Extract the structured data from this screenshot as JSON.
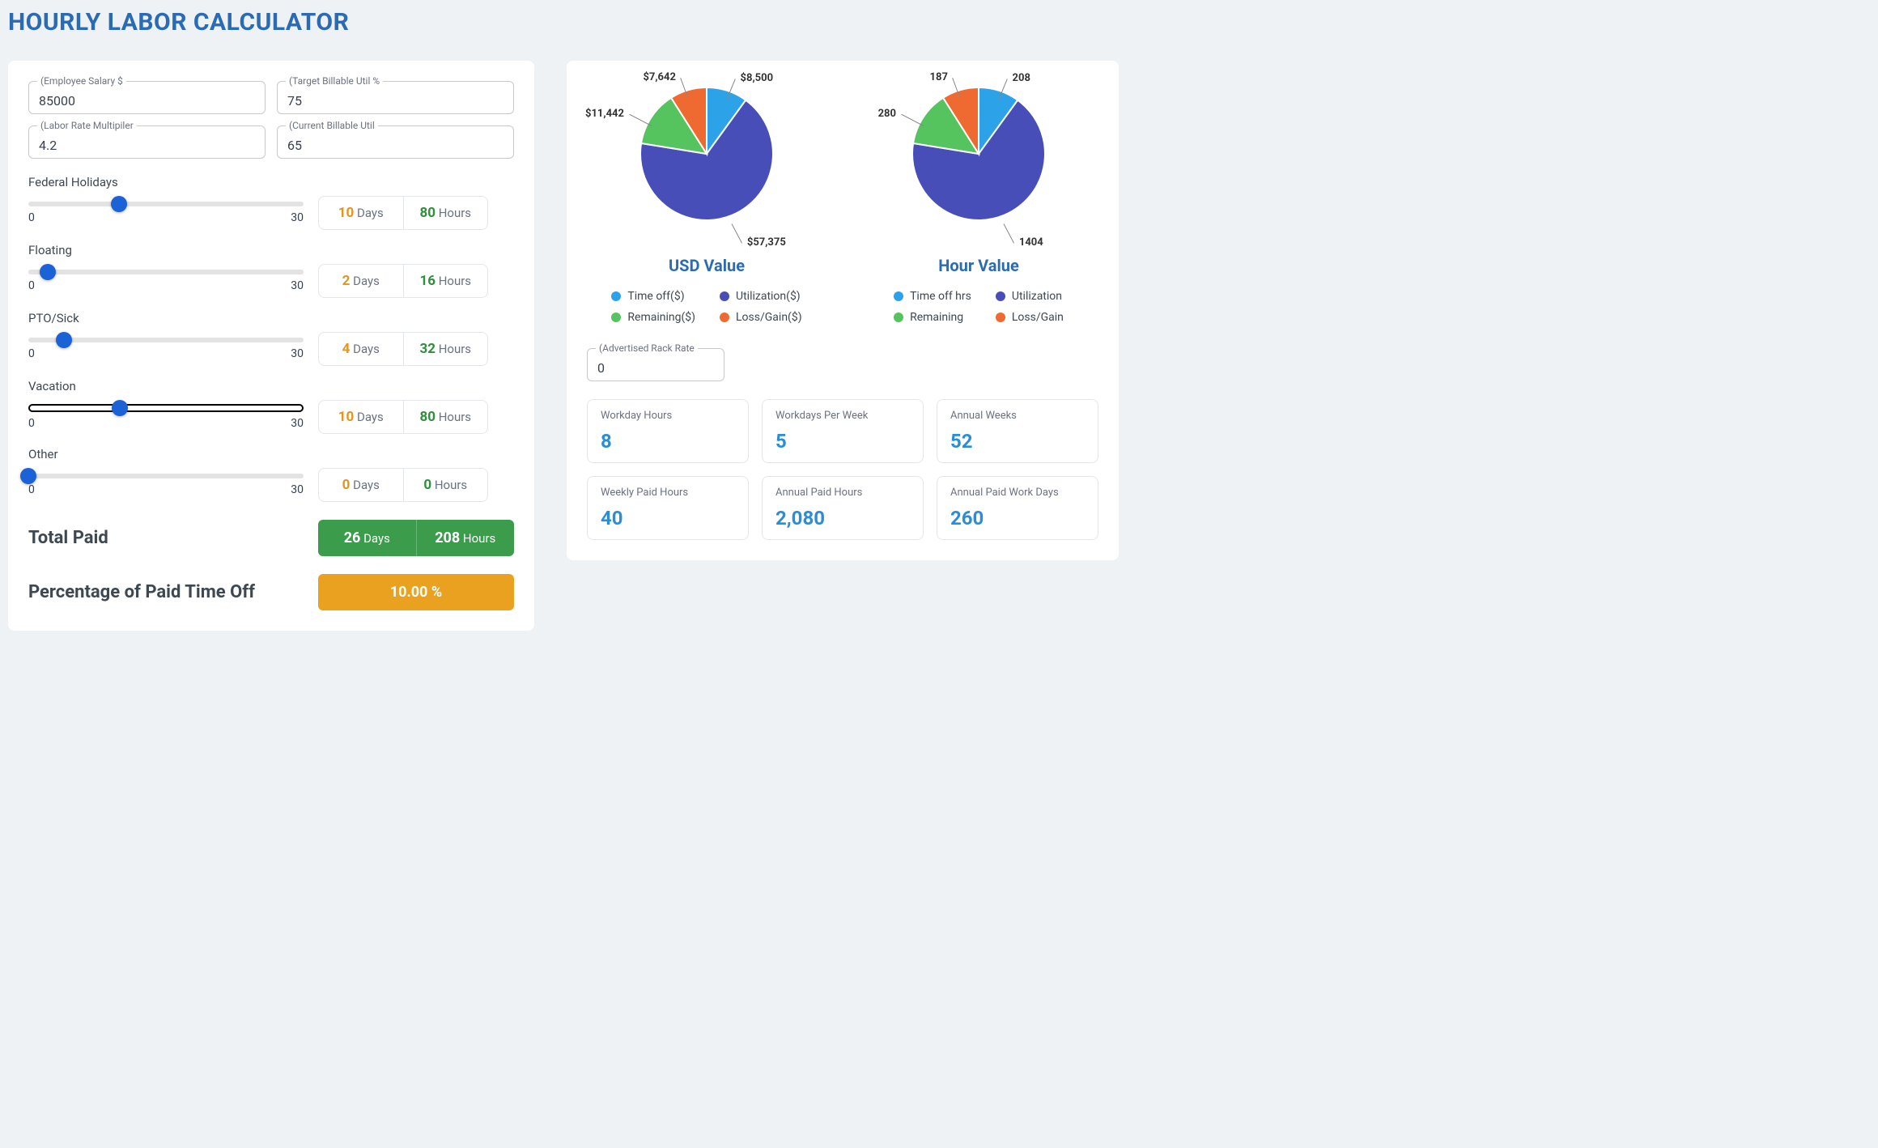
{
  "title": "HOURLY LABOR CALCULATOR",
  "inputs": {
    "salary": {
      "label": "Employee Salary $",
      "value": "85000"
    },
    "targetUtil": {
      "label": "Target Billable Util %",
      "value": "75"
    },
    "multiplier": {
      "label": "Labor Rate Multipiler",
      "value": "4.2"
    },
    "currentUtil": {
      "label": "Current Billable Util",
      "value": "65"
    }
  },
  "sliders": {
    "min": "0",
    "max": "30",
    "daysUnit": "Days",
    "hoursUnit": "Hours",
    "items": [
      {
        "label": "Federal Holidays",
        "days": "10",
        "hours": "80",
        "pct": 33,
        "active": false
      },
      {
        "label": "Floating",
        "days": "2",
        "hours": "16",
        "pct": 7,
        "active": false
      },
      {
        "label": "PTO/Sick",
        "days": "4",
        "hours": "32",
        "pct": 13,
        "active": false
      },
      {
        "label": "Vacation",
        "days": "10",
        "hours": "80",
        "pct": 33,
        "active": true
      },
      {
        "label": "Other",
        "days": "0",
        "hours": "0",
        "pct": 0,
        "active": false
      }
    ]
  },
  "totals": {
    "paid": {
      "label": "Total Paid",
      "days": "26",
      "hours": "208"
    },
    "pct": {
      "label": "Percentage of Paid Time Off",
      "value": "10.00 %"
    }
  },
  "chart_data": [
    {
      "type": "pie",
      "title": "USD Value",
      "series": [
        {
          "name": "Time off($)",
          "value": 8500,
          "label": "$8,500",
          "color": "#2ca2e8"
        },
        {
          "name": "Utilization($)",
          "value": 57375,
          "label": "$57,375",
          "color": "#484eb8"
        },
        {
          "name": "Remaining($)",
          "value": 11442,
          "label": "$11,442",
          "color": "#55c35e"
        },
        {
          "name": "Loss/Gain($)",
          "value": 7642,
          "label": "$7,642",
          "color": "#ef6a31"
        }
      ]
    },
    {
      "type": "pie",
      "title": "Hour Value",
      "series": [
        {
          "name": "Time off hrs",
          "value": 208,
          "label": "208",
          "color": "#2ca2e8"
        },
        {
          "name": "Utilization",
          "value": 1404,
          "label": "1404",
          "color": "#484eb8"
        },
        {
          "name": "Remaining",
          "value": 280,
          "label": "280",
          "color": "#55c35e"
        },
        {
          "name": "Loss/Gain",
          "value": 187,
          "label": "187",
          "color": "#ef6a31"
        }
      ]
    }
  ],
  "rack": {
    "label": "Advertised Rack Rate",
    "value": "0"
  },
  "stats": [
    {
      "label": "Workday Hours",
      "value": "8"
    },
    {
      "label": "Workdays Per Week",
      "value": "5"
    },
    {
      "label": "Annual Weeks",
      "value": "52"
    },
    {
      "label": "Weekly Paid Hours",
      "value": "40"
    },
    {
      "label": "Annual Paid Hours",
      "value": "2,080"
    },
    {
      "label": "Annual Paid Work Days",
      "value": "260"
    }
  ]
}
